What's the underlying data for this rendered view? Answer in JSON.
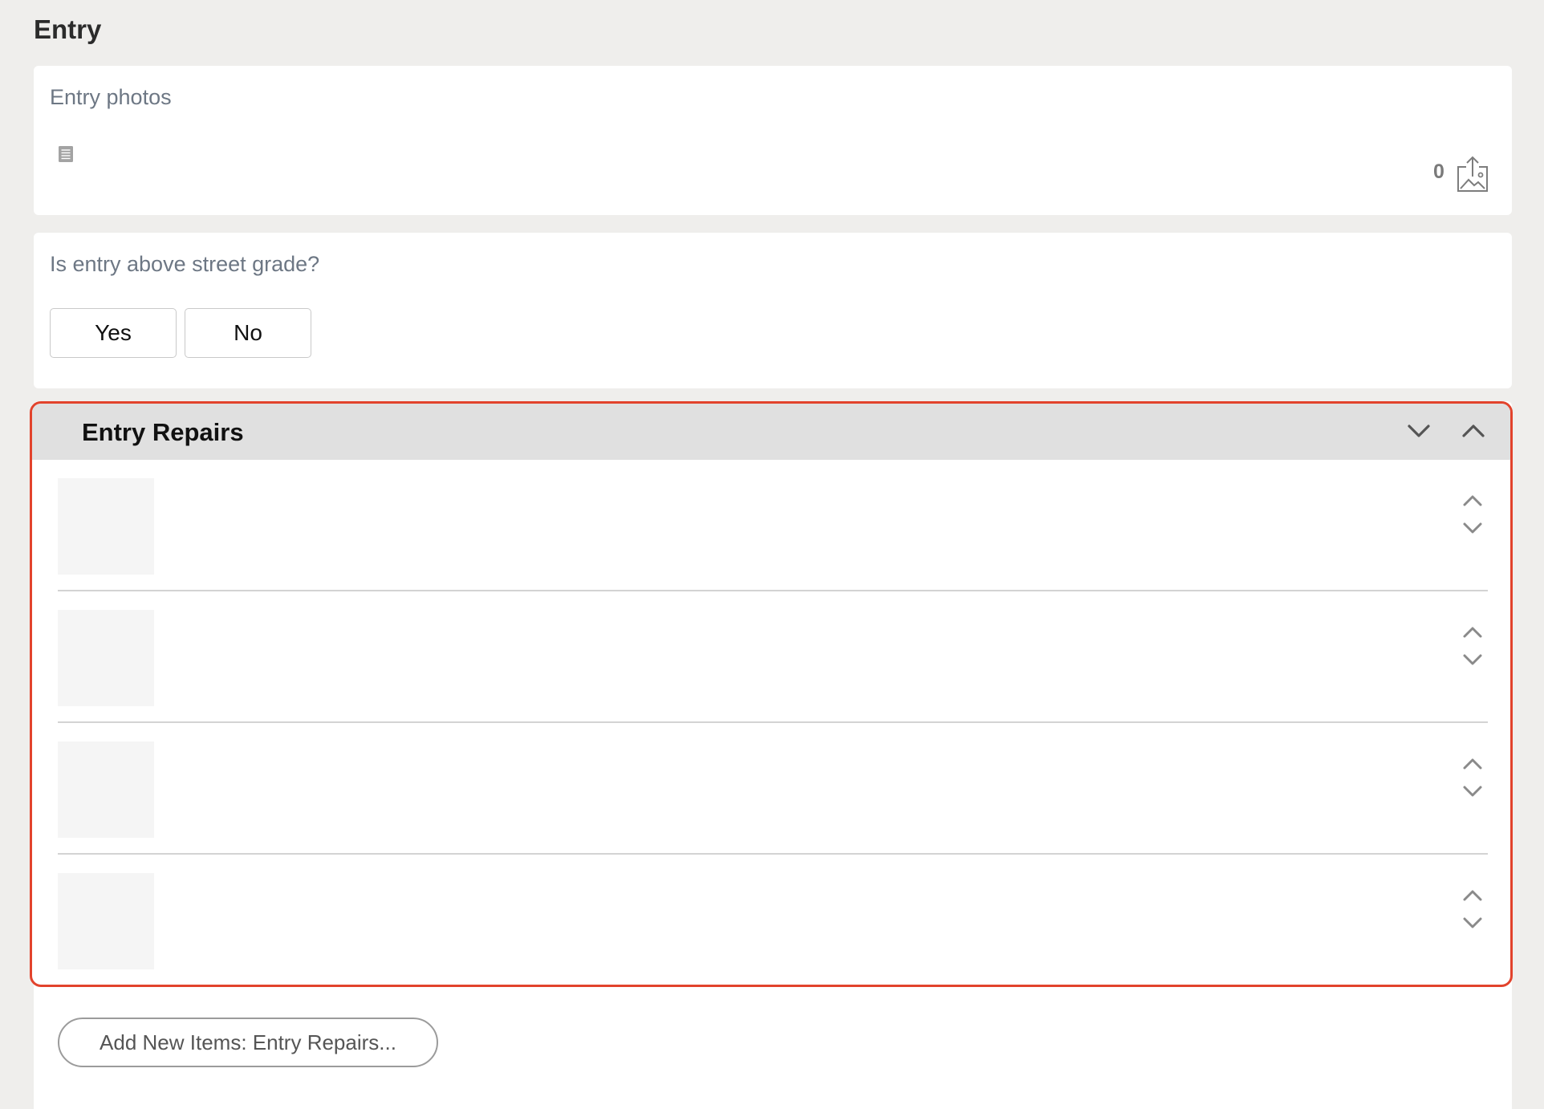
{
  "section": {
    "title": "Entry"
  },
  "photos": {
    "label": "Entry photos",
    "count": "0",
    "note_icon": "note-icon",
    "upload_icon": "image-upload-icon"
  },
  "grade_question": {
    "label": "Is entry above street grade?",
    "options": [
      "Yes",
      "No"
    ]
  },
  "repairs": {
    "title": "Entry Repairs",
    "header_icons": [
      "chevron-down-icon",
      "chevron-up-icon"
    ],
    "rows": [
      {
        "row_icons": [
          "chevron-up-icon",
          "chevron-down-icon"
        ]
      },
      {
        "row_icons": [
          "chevron-up-icon",
          "chevron-down-icon"
        ]
      },
      {
        "row_icons": [
          "chevron-up-icon",
          "chevron-down-icon"
        ]
      },
      {
        "row_icons": [
          "chevron-up-icon",
          "chevron-down-icon"
        ]
      }
    ],
    "add_button_label": "Add New Items: Entry Repairs..."
  },
  "colors": {
    "highlight_border": "#e2432c",
    "header_bg": "#e0e0e0",
    "page_bg": "#efeeec"
  }
}
